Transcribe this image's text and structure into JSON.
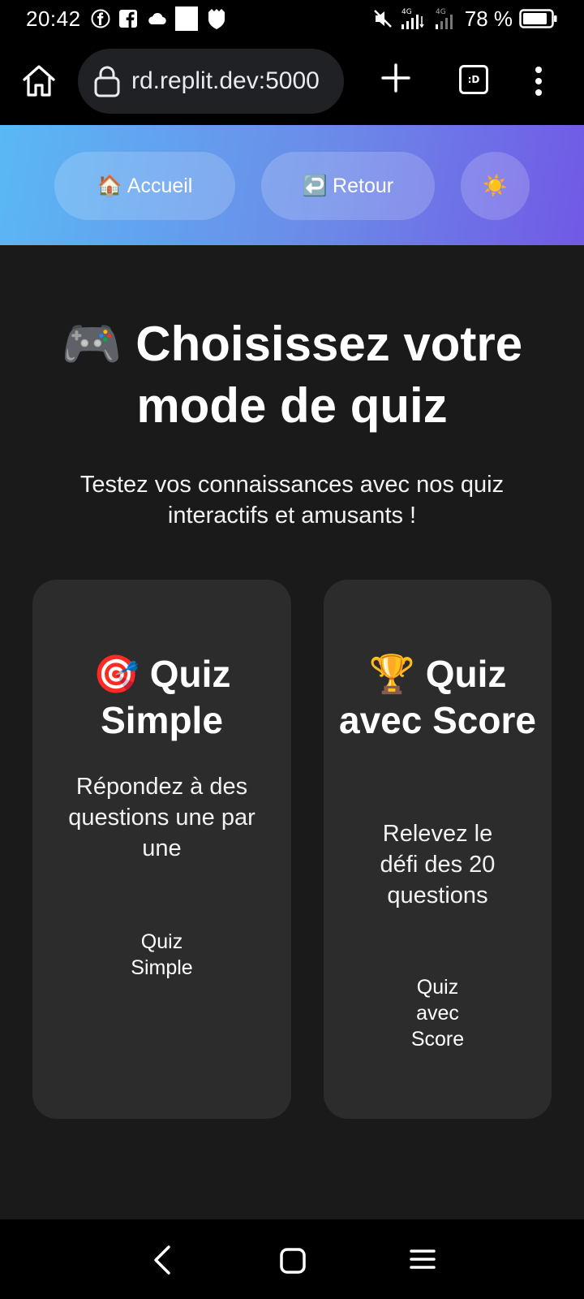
{
  "status_bar": {
    "time": "20:42",
    "battery_percent": "78 %",
    "icons": [
      "facebook-icon",
      "facebook-square-icon",
      "cloud-icon",
      "white-square-icon",
      "shield-icon",
      "mute-icon",
      "signal-4g-icon",
      "signal-4g-icon",
      "battery-icon"
    ]
  },
  "browser": {
    "url": "rd.replit.dev:5000",
    "tabs_label": ":D"
  },
  "header": {
    "nav": [
      {
        "emoji": "🏠",
        "label": "Accueil"
      },
      {
        "emoji": "↩️",
        "label": "Retour"
      },
      {
        "emoji": "☀️",
        "label": ""
      }
    ]
  },
  "main": {
    "title_emoji": "🎮",
    "title": "Choisissez votre mode de quiz",
    "subtitle": "Testez vos connaissances avec nos quiz interactifs et amusants !",
    "cards": [
      {
        "emoji": "🎯",
        "title": "Quiz Simple",
        "description": "Répondez à des questions une par une",
        "link": "Quiz Simple"
      },
      {
        "emoji": "🏆",
        "title": "Quiz avec Score",
        "description": "Relevez le défi des 20 questions",
        "link": "Quiz avec Score"
      }
    ]
  },
  "colors": {
    "background": "#1a1a1a",
    "card": "#2c2c2c",
    "header_gradient_start": "#5ab8f5",
    "header_gradient_end": "#7159e6"
  }
}
